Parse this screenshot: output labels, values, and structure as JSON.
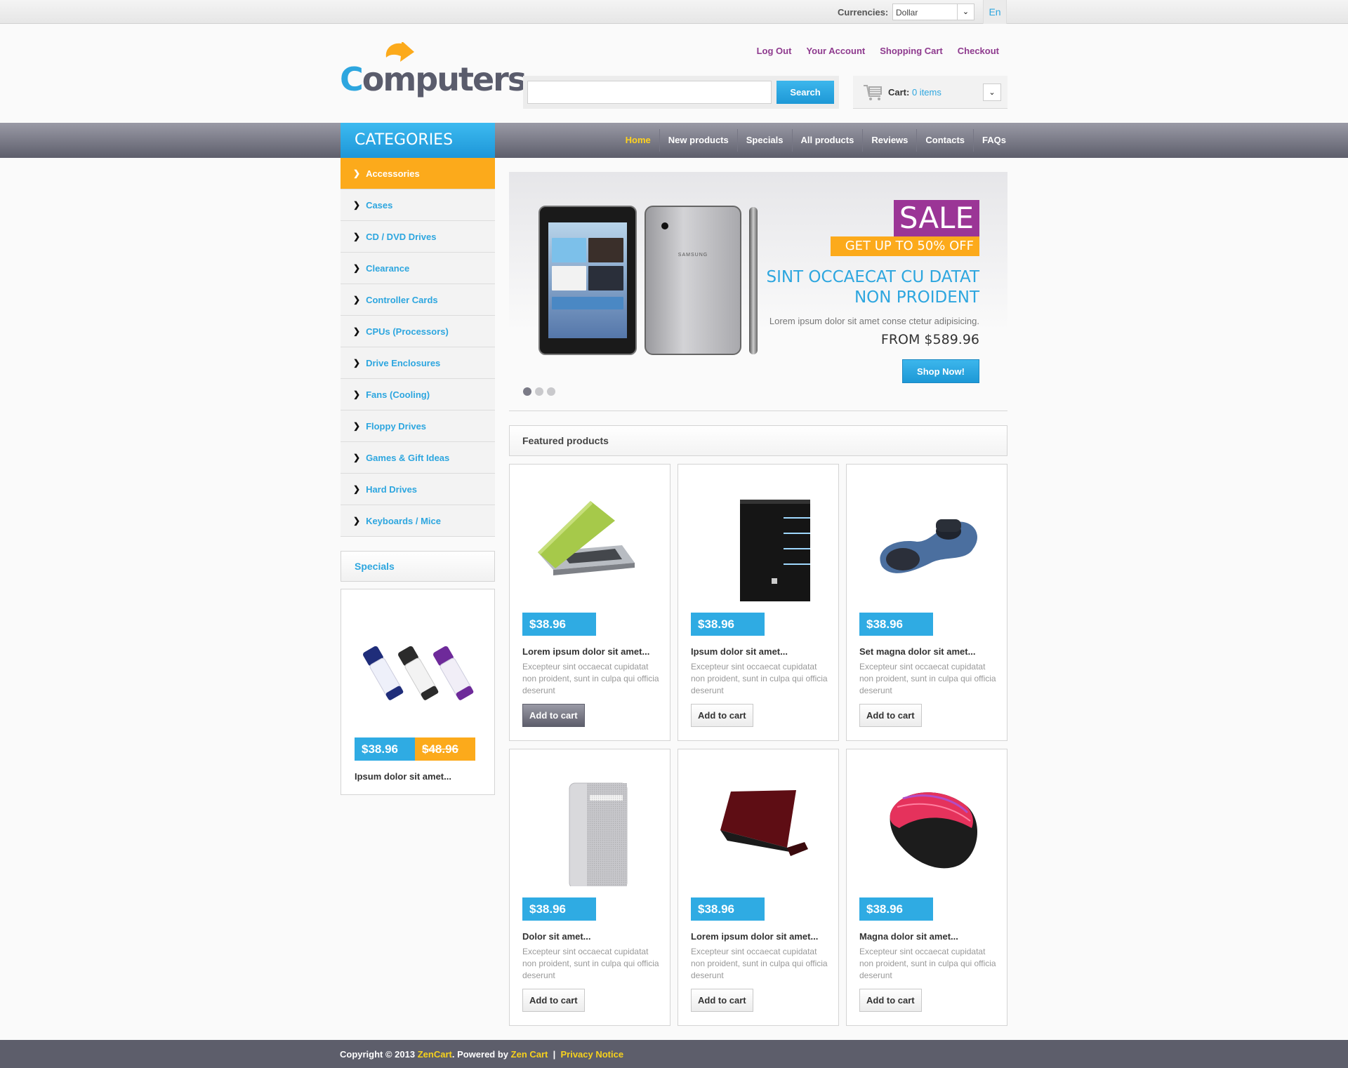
{
  "topbar": {
    "currency_label": "Currencies:",
    "currency_value": "Dollar",
    "language": "En"
  },
  "header": {
    "logo_text_c": "C",
    "logo_text_rest": "omputers",
    "links": [
      "Log Out",
      "Your Account",
      "Shopping Cart",
      "Checkout"
    ],
    "search": {
      "placeholder": "",
      "value": "",
      "button": "Search"
    },
    "cart": {
      "label": "Cart:",
      "items": "0 items"
    }
  },
  "nav": {
    "categories_title": "CATEGORIES",
    "items": [
      {
        "label": "Home",
        "active": true
      },
      {
        "label": "New products"
      },
      {
        "label": "Specials"
      },
      {
        "label": "All products"
      },
      {
        "label": "Reviews"
      },
      {
        "label": "Contacts"
      },
      {
        "label": "FAQs"
      }
    ]
  },
  "sidebar": {
    "categories": [
      {
        "label": "Accessories",
        "active": true
      },
      {
        "label": "Cases"
      },
      {
        "label": "CD / DVD Drives"
      },
      {
        "label": "Clearance"
      },
      {
        "label": "Controller Cards"
      },
      {
        "label": "CPUs (Processors)"
      },
      {
        "label": "Drive Enclosures"
      },
      {
        "label": "Fans (Cooling)"
      },
      {
        "label": "Floppy Drives"
      },
      {
        "label": "Games & Gift Ideas"
      },
      {
        "label": "Hard Drives"
      },
      {
        "label": "Keyboards / Mice"
      }
    ],
    "specials": {
      "title": "Specials",
      "price": "$38.96",
      "old_price": "$48.96",
      "name": "Ipsum dolor sit amet..."
    }
  },
  "slider": {
    "badge": "SALE",
    "offer": "GET UP TO 50% OFF",
    "title_line1": "SINT OCCAECAT CU DATAT",
    "title_line2": "NON PROIDENT",
    "subtitle": "Lorem ipsum dolor sit amet conse ctetur adipisicing.",
    "price": "FROM $589.96",
    "button": "Shop Now!",
    "device_brand": "SAMSUNG",
    "slides_count": 3,
    "active_slide": 1
  },
  "featured": {
    "title": "Featured products",
    "products": [
      {
        "price": "$38.96",
        "name": "Lorem ipsum dolor sit amet...",
        "desc": "Excepteur sint occaecat cupidatat non proident, sunt in culpa qui officia deserunt",
        "button": "Add to cart",
        "image": "green-laptop"
      },
      {
        "price": "$38.96",
        "name": "Ipsum dolor sit amet...",
        "desc": "Excepteur sint occaecat cupidatat non proident, sunt in culpa qui officia deserunt",
        "button": "Add to cart",
        "image": "black-tower-pc"
      },
      {
        "price": "$38.96",
        "name": "Set magna dolor sit amet...",
        "desc": "Excepteur sint occaecat cupidatat non proident, sunt in culpa qui officia deserunt",
        "button": "Add to cart",
        "image": "3d-mouse"
      },
      {
        "price": "$38.96",
        "name": "Dolor sit amet...",
        "desc": "Excepteur sint occaecat cupidatat non proident, sunt in culpa qui officia deserunt",
        "button": "Add to cart",
        "image": "silver-tower"
      },
      {
        "price": "$38.96",
        "name": "Lorem ipsum dolor sit amet...",
        "desc": "Excepteur sint occaecat cupidatat non proident, sunt in culpa qui officia deserunt",
        "button": "Add to cart",
        "image": "red-netbook"
      },
      {
        "price": "$38.96",
        "name": "Magna dolor sit amet...",
        "desc": "Excepteur sint occaecat cupidatat non proident, sunt in culpa qui officia deserunt",
        "button": "Add to cart",
        "image": "pink-mouse"
      }
    ]
  },
  "footer": {
    "copyright": "Copyright © 2013 ",
    "brand_link": "ZenCart",
    "powered": ". Powered by ",
    "zen_link": "Zen Cart",
    "sep": "  |  ",
    "privacy": "Privacy Notice"
  },
  "colors": {
    "accent_blue": "#2da6df",
    "accent_orange": "#fcaa1b",
    "sale_purple": "#9b3596",
    "link_purple": "#8e3a8e",
    "nav_gray": "#5d5e6b",
    "footer_yellow": "#f7d21c"
  }
}
